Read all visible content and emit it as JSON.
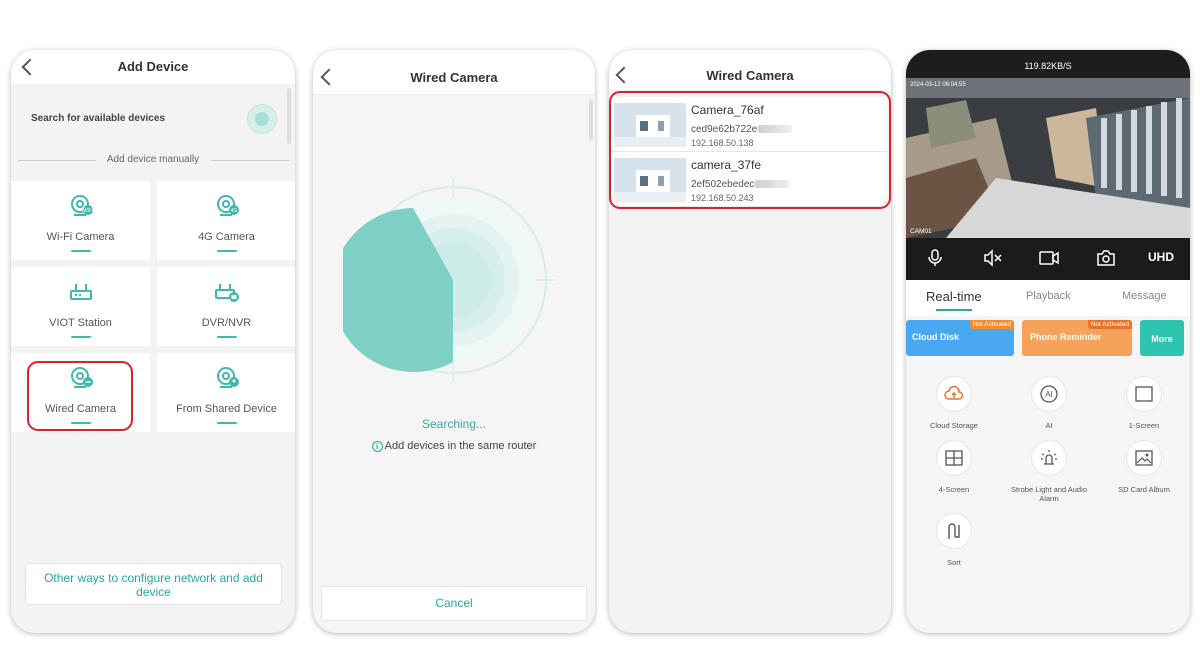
{
  "phone1": {
    "title": "Add Device",
    "search_label": "Search for available devices",
    "manual_label": "Add device manually",
    "tiles": [
      {
        "label": "Wi-Fi Camera"
      },
      {
        "label": "4G Camera"
      },
      {
        "label": "VIOT Station"
      },
      {
        "label": "DVR/NVR"
      },
      {
        "label": "Wired Camera"
      },
      {
        "label": "From Shared Device"
      }
    ],
    "other_ways": "Other ways to configure network and add device"
  },
  "phone2": {
    "title": "Wired Camera",
    "searching": "Searching...",
    "hint": "Add devices in the same router",
    "cancel": "Cancel"
  },
  "phone3": {
    "title": "Wired Camera",
    "devices": [
      {
        "name": "Camera_76af",
        "uid": "ced9e62b722e",
        "ip": "192.168.50.138"
      },
      {
        "name": "camera_37fe",
        "uid": "2ef502ebedec",
        "ip": "192.168.50.243"
      }
    ]
  },
  "phone4": {
    "speed": "119.82KB/S",
    "timestamp": "2024-03-12 06:04:55",
    "cam_label": "CAM01",
    "quality": "UHD",
    "tabs": [
      "Real-time",
      "Playback",
      "Message"
    ],
    "promos": {
      "cloud": {
        "label": "Cloud Disk",
        "tag": "Not Activated"
      },
      "phone": {
        "label": "Phone Reminder",
        "tag": "Not Activated"
      },
      "more": "More"
    },
    "grid": [
      {
        "label": "Cloud Storage",
        "icon": "cloud-upload-icon"
      },
      {
        "label": "AI",
        "icon": "ai-icon"
      },
      {
        "label": "1-Screen",
        "icon": "single-screen-icon"
      },
      {
        "label": "4-Screen",
        "icon": "quad-screen-icon"
      },
      {
        "label": "Strobe Light and Audio Alarm",
        "icon": "strobe-light-icon"
      },
      {
        "label": "SD Card Album",
        "icon": "image-album-icon"
      },
      {
        "label": "Sort",
        "icon": "sort-icon"
      }
    ]
  },
  "colors": {
    "accent": "#3fb8ad",
    "highlight": "#d9222a",
    "cloud": "#4aa8f0",
    "phone": "#f5a35a",
    "more": "#2ec4b0"
  }
}
